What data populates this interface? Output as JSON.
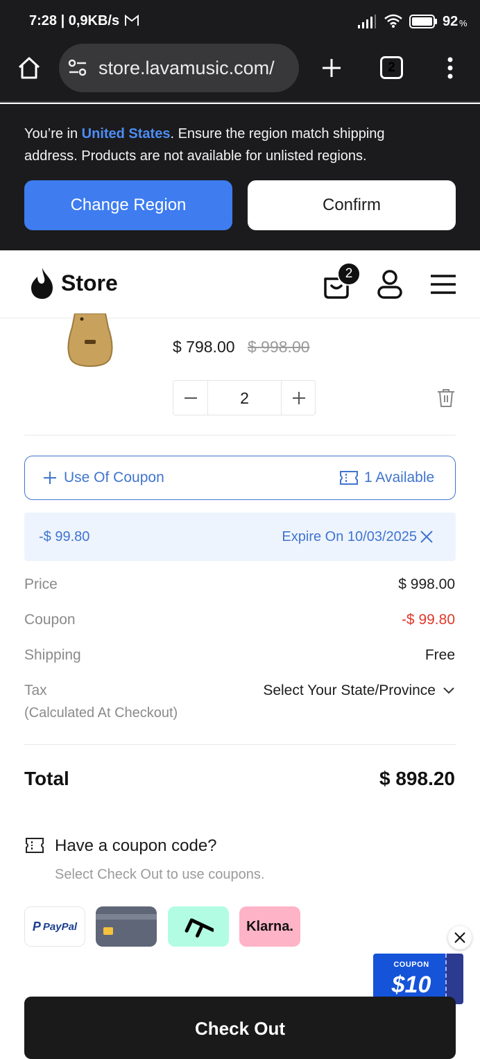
{
  "status_bar": {
    "time_speed": "7:28 | 0,9KB/s",
    "battery": "92",
    "battery_unit": "%"
  },
  "browser": {
    "url": "store.lavamusic.com/",
    "tab_count": "2"
  },
  "region_banner": {
    "text_prefix": "You’re in ",
    "region": "United States",
    "text_suffix": ". Ensure the region match shipping address. Products are not available for unlisted regions.",
    "change_label": "Change Region",
    "confirm_label": "Confirm"
  },
  "store_header": {
    "title": "Store",
    "cart_count": "2"
  },
  "cart_item": {
    "price": "$ 798.00",
    "original_price": "$ 998.00",
    "quantity": "2"
  },
  "coupon": {
    "use_label": "Use Of Coupon",
    "available": "1 Available",
    "applied_amount": "-$ 99.80",
    "expire": "Expire On 10/03/2025"
  },
  "summary": {
    "price_label": "Price",
    "price_value": "$ 998.00",
    "coupon_label": "Coupon",
    "coupon_value": "-$ 99.80",
    "shipping_label": "Shipping",
    "shipping_value": "Free",
    "tax_label": "Tax",
    "tax_note": "(Calculated At Checkout)",
    "tax_select": "Select Your State/Province",
    "total_label": "Total",
    "total_value": "$ 898.20"
  },
  "coupon_code": {
    "title": "Have a coupon code?",
    "hint": "Select Check Out to use coupons."
  },
  "payment_methods": {
    "paypal": "PayPal",
    "klarna": "Klarna."
  },
  "promo": {
    "label": "COUPON",
    "amount": "$10"
  },
  "checkout_label": "Check Out",
  "colors": {
    "accent_blue": "#3e7cf0",
    "link_blue": "#3f74cf",
    "coupon_red": "#e0382b",
    "dark_bg": "#1b1b1d"
  }
}
